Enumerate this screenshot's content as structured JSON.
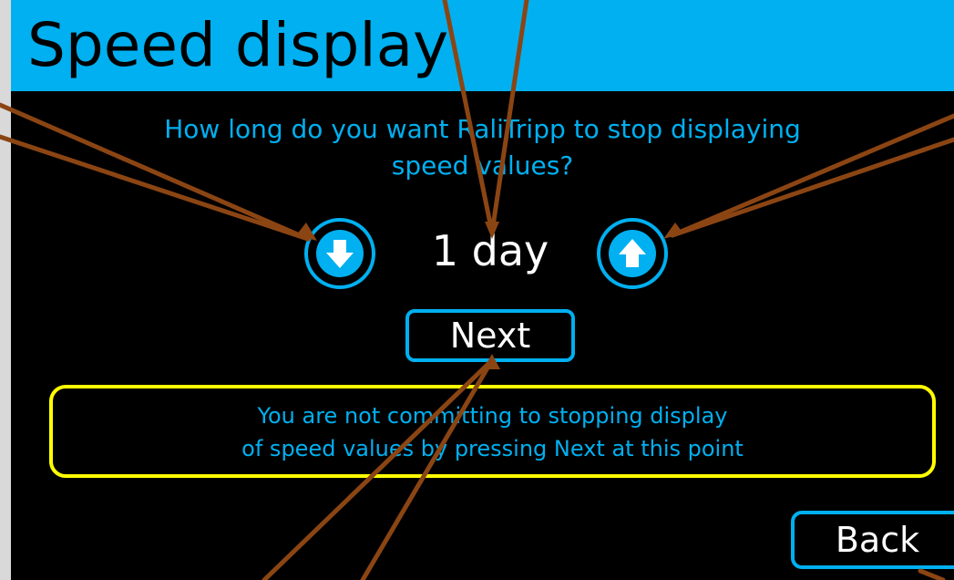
{
  "header": {
    "title": "Speed display"
  },
  "prompt": {
    "line1": "How long do you want RaliTripp to stop displaying",
    "line2": "speed values?"
  },
  "duration": {
    "value": "1 day"
  },
  "controls": {
    "decrease_icon": "down-arrow-circle-icon",
    "increase_icon": "up-arrow-circle-icon",
    "next_label": "Next",
    "back_label": "Back"
  },
  "note": {
    "line1": "You are not committing to stopping display",
    "line2": "of speed values by pressing Next at this point"
  },
  "colors": {
    "header_bg": "#00b0f0",
    "screen_bg": "#000000",
    "accent": "#00b0f0",
    "note_border": "#ffff00",
    "callout_line": "#8b4513",
    "frame": "#d9d9d9"
  }
}
